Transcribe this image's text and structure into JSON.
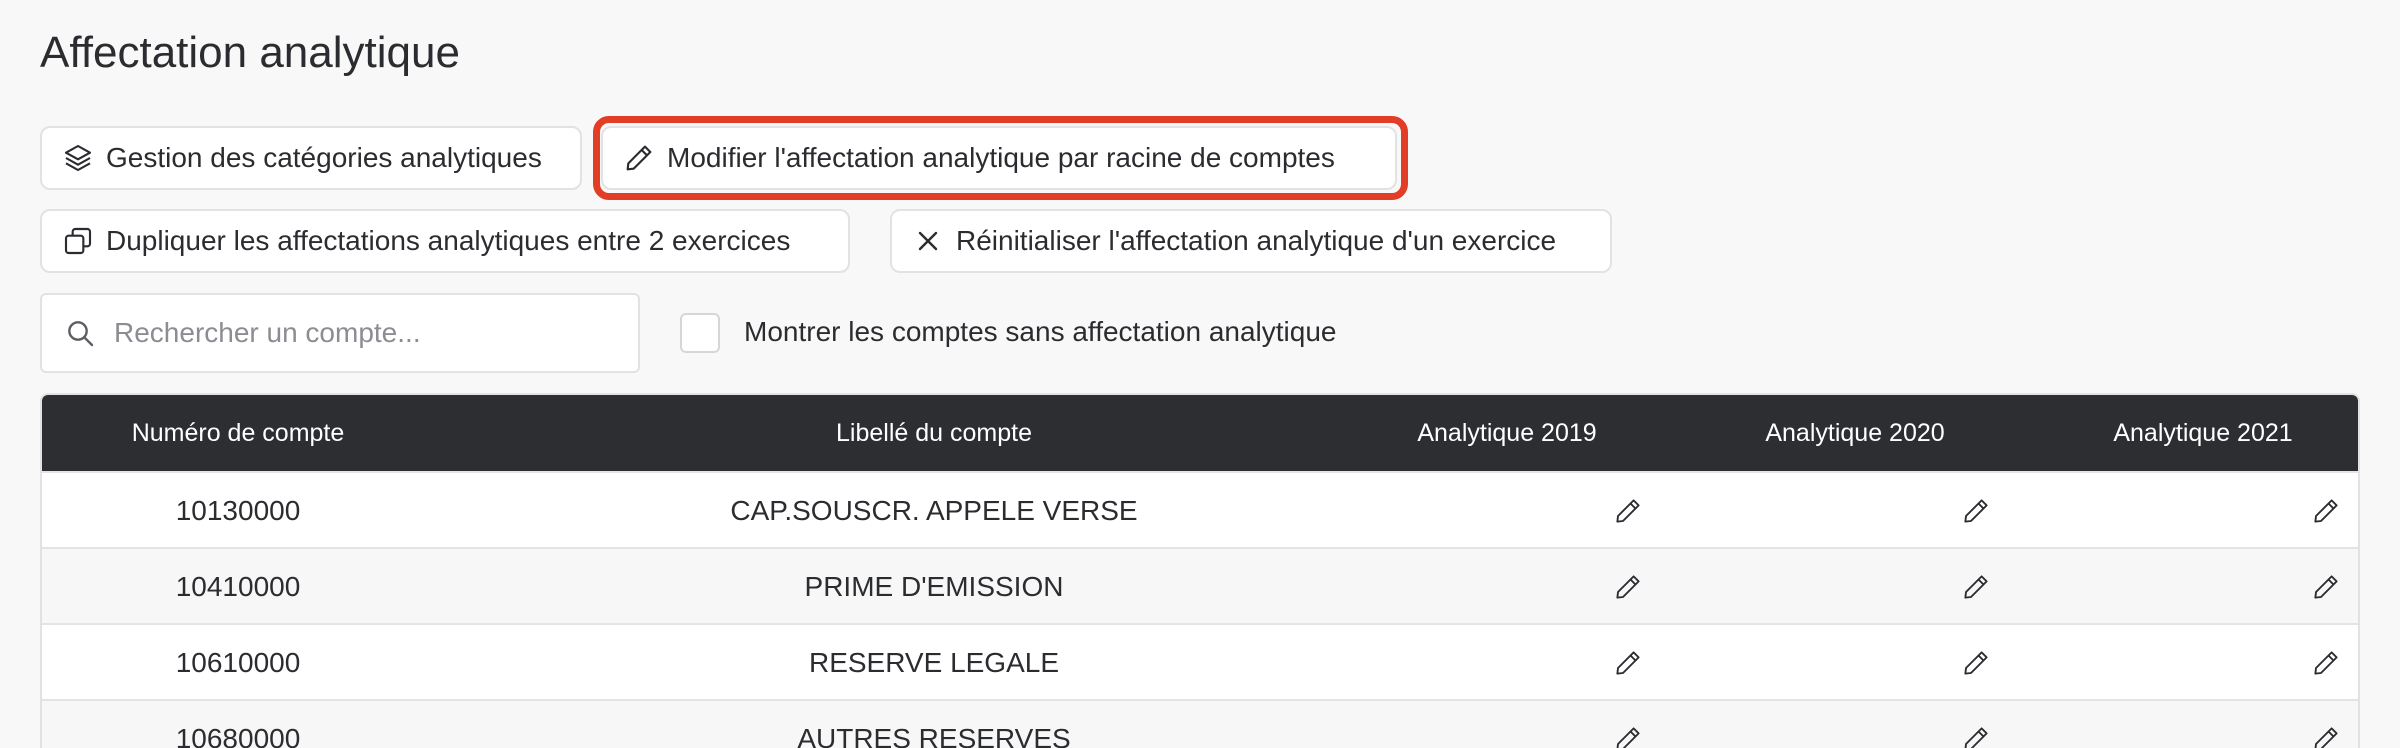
{
  "page": {
    "title": "Affectation analytique"
  },
  "actions": {
    "categories_label": "Gestion des catégories analytiques",
    "modify_label": "Modifier l'affectation analytique par racine de comptes",
    "duplicate_label": "Dupliquer les affectations analytiques entre 2 exercices",
    "reset_label": "Réinitialiser l'affectation analytique d'un exercice"
  },
  "filters": {
    "search_placeholder": "Rechercher un compte...",
    "search_value": "",
    "show_unassigned_label": "Montrer les comptes sans affectation analytique",
    "show_unassigned_checked": false
  },
  "table": {
    "headers": {
      "number": "Numéro de compte",
      "label": "Libellé du compte",
      "a2019": "Analytique 2019",
      "a2020": "Analytique 2020",
      "a2021": "Analytique 2021"
    },
    "rows": [
      {
        "number": "10130000",
        "label": "CAP.SOUSCR. APPELE VERSE"
      },
      {
        "number": "10410000",
        "label": "PRIME D'EMISSION"
      },
      {
        "number": "10610000",
        "label": "RESERVE LEGALE"
      },
      {
        "number": "10680000",
        "label": "AUTRES RESERVES"
      }
    ]
  },
  "icons": {
    "categories": "layers-icon",
    "modify": "pencil-icon",
    "duplicate": "copy-icon",
    "reset": "close-icon",
    "search": "search-icon",
    "edit": "pencil-icon"
  },
  "colors": {
    "header_bg": "#2d2e32",
    "highlight": "#e23d26",
    "page_bg": "#f8f8f8"
  }
}
